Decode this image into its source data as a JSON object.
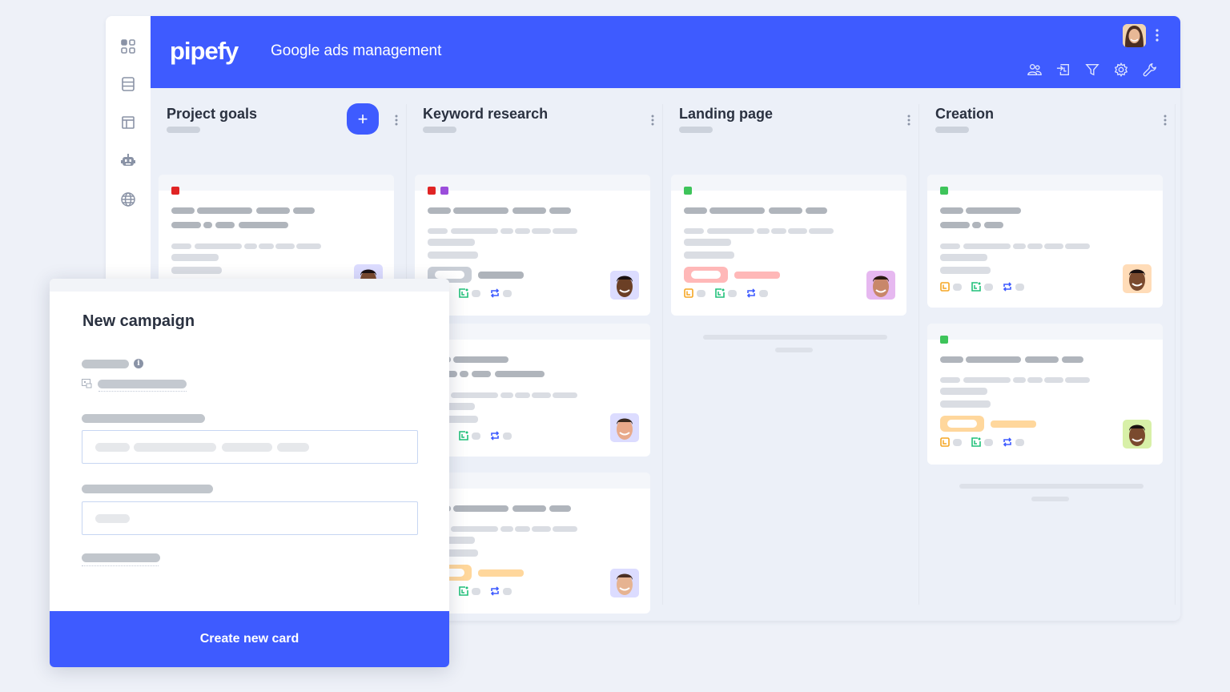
{
  "app": {
    "brand": "pipefy",
    "pipe_title": "Google ads management",
    "accent_color": "#3e5bff"
  },
  "rail": {
    "items": [
      {
        "icon": "apps-grid-icon"
      },
      {
        "icon": "database-icon"
      },
      {
        "icon": "layout-icon"
      },
      {
        "icon": "bot-icon"
      },
      {
        "icon": "globe-icon"
      }
    ]
  },
  "topbar": {
    "actions": [
      {
        "icon": "members-icon"
      },
      {
        "icon": "import-icon"
      },
      {
        "icon": "filter-icon"
      },
      {
        "icon": "settings-gear-icon"
      },
      {
        "icon": "wrench-icon"
      }
    ]
  },
  "phases": [
    {
      "title": "Project goals",
      "add_label": "+",
      "cards": [
        {
          "labels": [
            "#e02424"
          ],
          "avatar_bg": "#dcdcff"
        }
      ]
    },
    {
      "title": "Keyword research",
      "cards": [
        {
          "labels": [
            "#e02424",
            "#9b4ddb"
          ],
          "tag_color": "#c9ced6",
          "avatar_bg": "#dcdcff"
        },
        {
          "labels": [],
          "avatar_bg": "#dcdcff"
        },
        {
          "labels": [],
          "tag_color": "#ffd79c",
          "avatar_bg": "#dcdcff"
        }
      ]
    },
    {
      "title": "Landing page",
      "cards": [
        {
          "labels": [
            "#3ec45a"
          ],
          "tag_color": "#ffb8b8",
          "avatar_bg": "#e6b8f0"
        }
      ]
    },
    {
      "title": "Creation",
      "cards": [
        {
          "labels": [
            "#3ec45a"
          ],
          "avatar_bg": "#ffdcb8"
        },
        {
          "labels": [
            "#3ec45a"
          ],
          "tag_color": "#ffd79c",
          "avatar_bg": "#d8f0a8"
        }
      ]
    }
  ],
  "modal": {
    "title": "New campaign",
    "submit_label": "Create new card",
    "info_glyph": "i"
  }
}
